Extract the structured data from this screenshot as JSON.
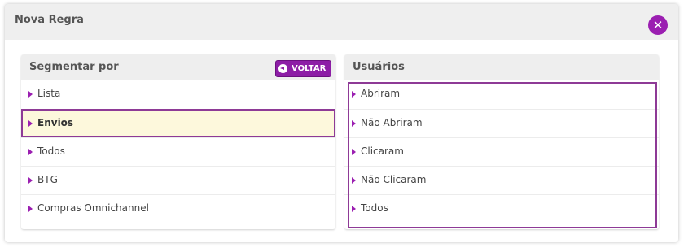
{
  "modal": {
    "title": "Nova Regra",
    "close_symbol": "✕"
  },
  "left_panel": {
    "title": "Segmentar por",
    "back_button": "VOLTAR",
    "items": [
      {
        "label": "Lista"
      },
      {
        "label": "Envios",
        "selected": true
      },
      {
        "label": "Todos"
      },
      {
        "label": "BTG"
      },
      {
        "label": "Compras Omnichannel"
      }
    ]
  },
  "right_panel": {
    "title": "Usuários",
    "items": [
      {
        "label": "Abriram"
      },
      {
        "label": "Não Abriram"
      },
      {
        "label": "Clicaram"
      },
      {
        "label": "Não Clicaram"
      },
      {
        "label": "Todos"
      }
    ]
  },
  "colors": {
    "accent": "#9b1fb1",
    "selection_border": "#8e3a96",
    "selected_background": "#fdf8dc"
  },
  "icons": {
    "close": "close-icon",
    "back": "arrow-left-circle-icon",
    "item_bullet": "caret-right-icon"
  }
}
